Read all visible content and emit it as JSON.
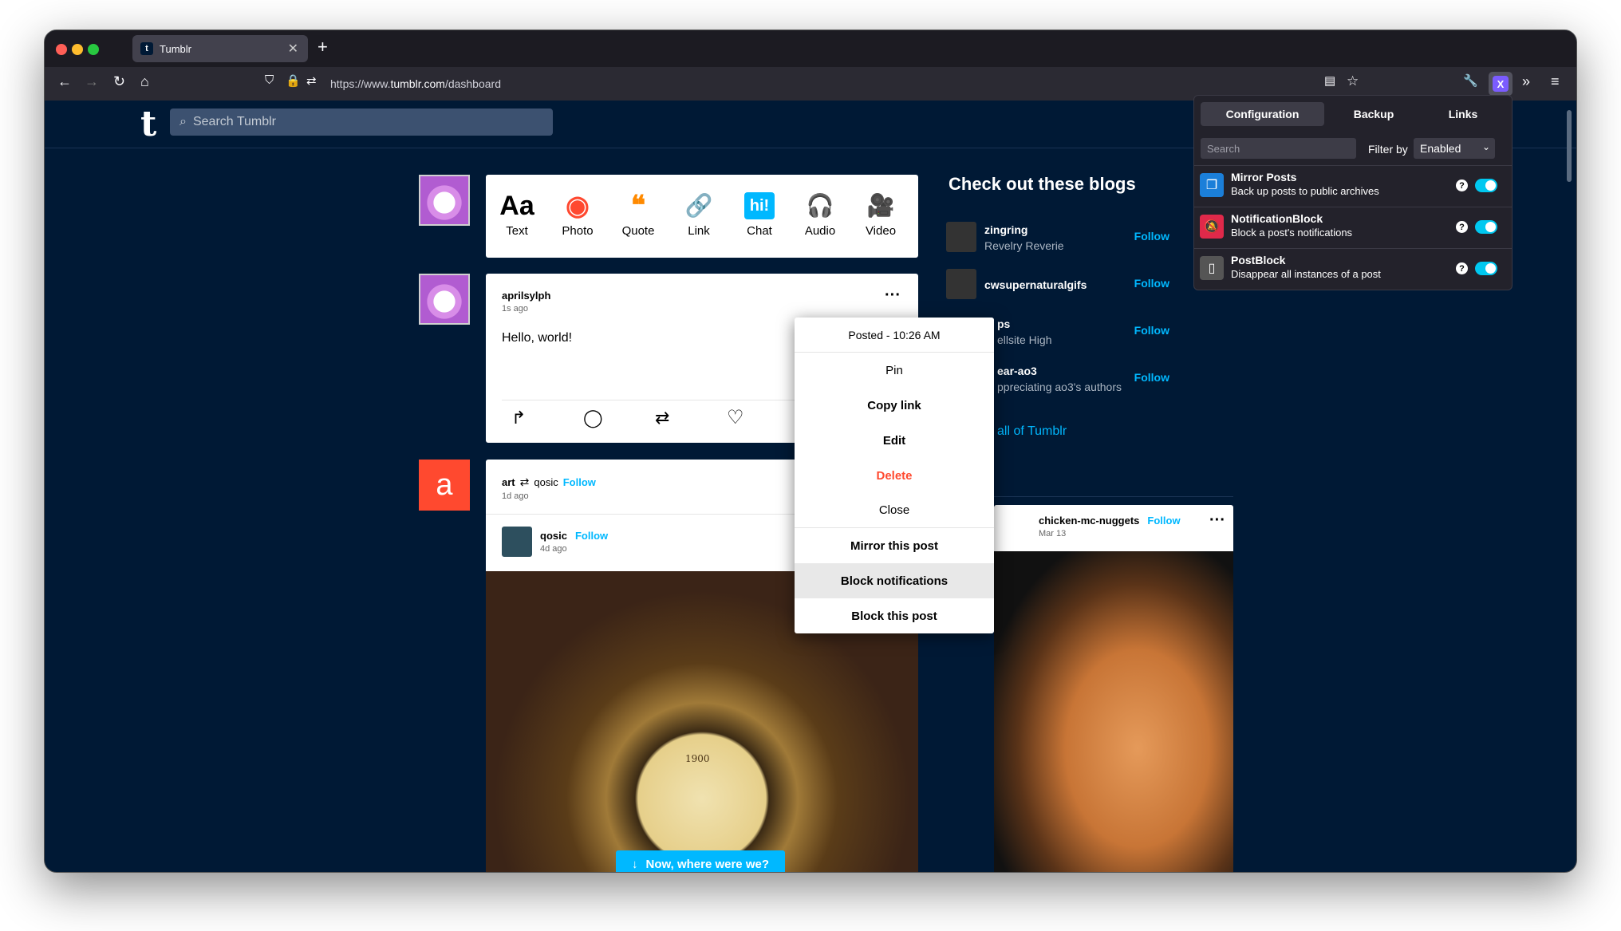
{
  "browser": {
    "tab_title": "Tumblr",
    "url_prefix": "https://www.",
    "url_domain": "tumblr.com",
    "url_path": "/dashboard"
  },
  "header": {
    "logo": "t",
    "search_placeholder": "Search Tumblr"
  },
  "composer": {
    "items": [
      {
        "glyph": "Aa",
        "label": "Text",
        "color": "#000000"
      },
      {
        "glyph": "◉",
        "label": "Photo",
        "color": "#ff4930"
      },
      {
        "glyph": "❝",
        "label": "Quote",
        "color": "#ff8a00"
      },
      {
        "glyph": "🔗",
        "label": "Link",
        "color": "#00cf35"
      },
      {
        "glyph": "hi!",
        "label": "Chat",
        "color": "#00b8ff"
      },
      {
        "glyph": "🎧",
        "label": "Audio",
        "color": "#7c5cff"
      },
      {
        "glyph": "🎥",
        "label": "Video",
        "color": "#ff62ce"
      }
    ]
  },
  "post1": {
    "user": "aprilsylph",
    "ago": "1s ago",
    "body": "Hello, world!"
  },
  "post2": {
    "user": "art",
    "reblog_user": "qosic",
    "follow": "Follow",
    "ago": "1d ago",
    "inner_user": "qosic",
    "inner_follow": "Follow",
    "inner_ago": "4d ago",
    "avatar_letter": "a",
    "clock_label": "1900",
    "jump_button": "Now, where were we?"
  },
  "menu": {
    "posted": "Posted - 10:26 AM",
    "items": [
      "Pin",
      "Copy link",
      "Edit",
      "Delete",
      "Close",
      "Mirror this post",
      "Block notifications",
      "Block this post"
    ]
  },
  "sidebar": {
    "title": "Check out these blogs",
    "blogs": [
      {
        "name": "zingring",
        "title": "Revelry Reverie",
        "follow": "Follow"
      },
      {
        "name": "cwsupernaturalgifs",
        "title": "",
        "follow": "Follow"
      },
      {
        "name": "ps",
        "title": "ellsite High",
        "follow": "Follow"
      },
      {
        "name": "ear-ao3",
        "title": "ppreciating ao3's authors",
        "follow": "Follow"
      }
    ],
    "explore": "all of Tumblr",
    "radar_user": "chicken-mc-nuggets",
    "radar_follow": "Follow",
    "radar_ago": "Mar 13"
  },
  "extension": {
    "tabs": [
      "Configuration",
      "Backup",
      "Links"
    ],
    "search_placeholder": "Search",
    "filter_label": "Filter by",
    "filter_value": "Enabled",
    "features": [
      {
        "name": "Mirror Posts",
        "desc": "Back up posts to public archives",
        "icon_color": "#1b7fd9"
      },
      {
        "name": "NotificationBlock",
        "desc": "Block a post's notifications",
        "icon_color": "#e0294a"
      },
      {
        "name": "PostBlock",
        "desc": "Disappear all instances of a post",
        "icon_color": "#555555"
      }
    ],
    "help": "?"
  }
}
